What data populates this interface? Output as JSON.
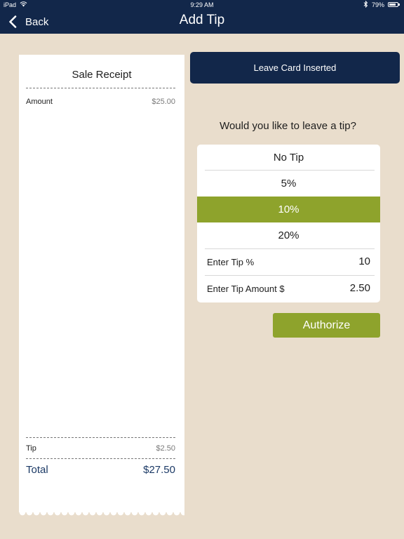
{
  "status_bar": {
    "carrier": "iPad",
    "time": "9:29 AM",
    "battery": "79%",
    "battery_level": 0.79
  },
  "nav": {
    "back_label": "Back",
    "title": "Add Tip"
  },
  "receipt": {
    "title": "Sale Receipt",
    "amount_label": "Amount",
    "amount_value": "$25.00",
    "tip_label": "Tip",
    "tip_value": "$2.50",
    "total_label": "Total",
    "total_value": "$27.50"
  },
  "actions": {
    "leave_card_label": "Leave Card Inserted",
    "authorize_label": "Authorize"
  },
  "tip": {
    "question": "Would you like to leave a tip?",
    "options": [
      "No Tip",
      "5%",
      "10%",
      "20%"
    ],
    "selected": "10%",
    "percent_label": "Enter Tip %",
    "percent_value": "10",
    "amount_label": "Enter Tip Amount $",
    "amount_value": "2.50"
  },
  "colors": {
    "navy": "#12274a",
    "accent_green": "#8ea32c",
    "background": "#e9ddcc",
    "total_blue": "#1c3a66"
  }
}
